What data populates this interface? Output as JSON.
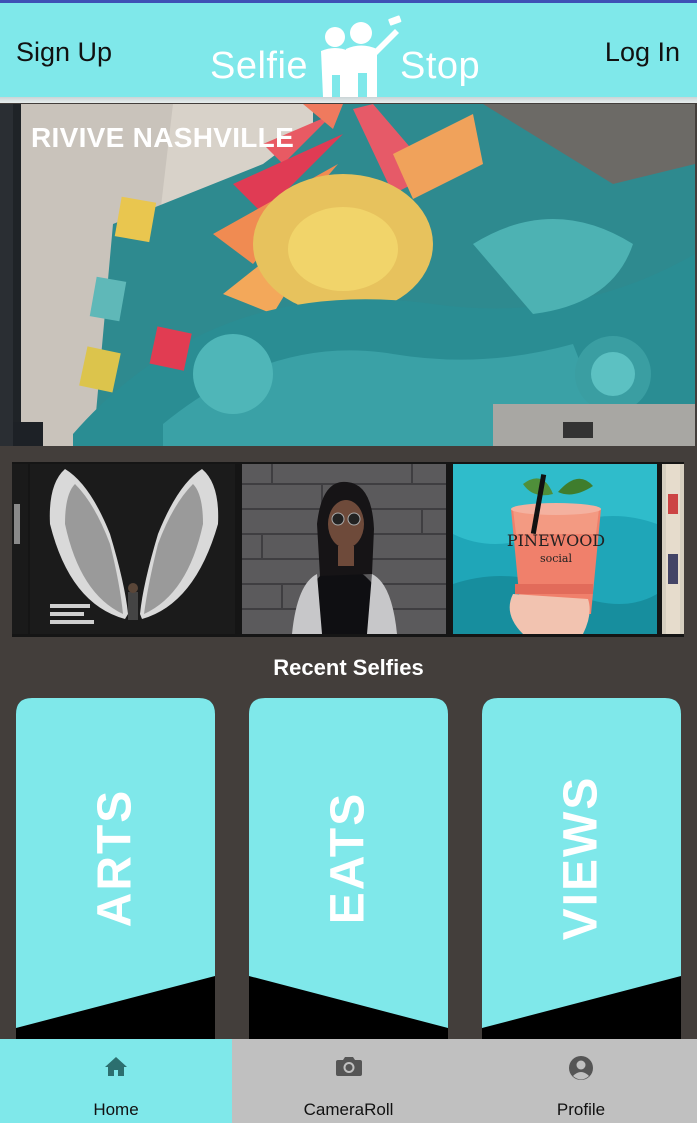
{
  "header": {
    "signup_label": "Sign Up",
    "login_label": "Log In",
    "logo_word_1": "Selfie",
    "logo_word_2": "Stop"
  },
  "hero": {
    "title": "RIVIVE NASHVILLE"
  },
  "gallery": {
    "items": [
      {
        "name": "wings mural selfie"
      },
      {
        "name": "brick wall portrait"
      },
      {
        "name": "pinewood social drink",
        "cup_text": "PINEWOOD",
        "cup_sub": "social"
      },
      {
        "name": "partial photo"
      }
    ]
  },
  "recent": {
    "title": "Recent Selfies"
  },
  "categories": [
    {
      "label": "ARTS"
    },
    {
      "label": "EATS"
    },
    {
      "label": "VIEWS"
    }
  ],
  "tabs": [
    {
      "label": "Home",
      "icon": "home-icon",
      "active": true
    },
    {
      "label": "CameraRoll",
      "icon": "camera-icon",
      "active": false
    },
    {
      "label": "Profile",
      "icon": "profile-icon",
      "active": false
    }
  ],
  "colors": {
    "accent": "#7fe8ea",
    "background": "#433e3b",
    "tabbar": "#c0c0c0",
    "topline": "#3f51b5"
  }
}
